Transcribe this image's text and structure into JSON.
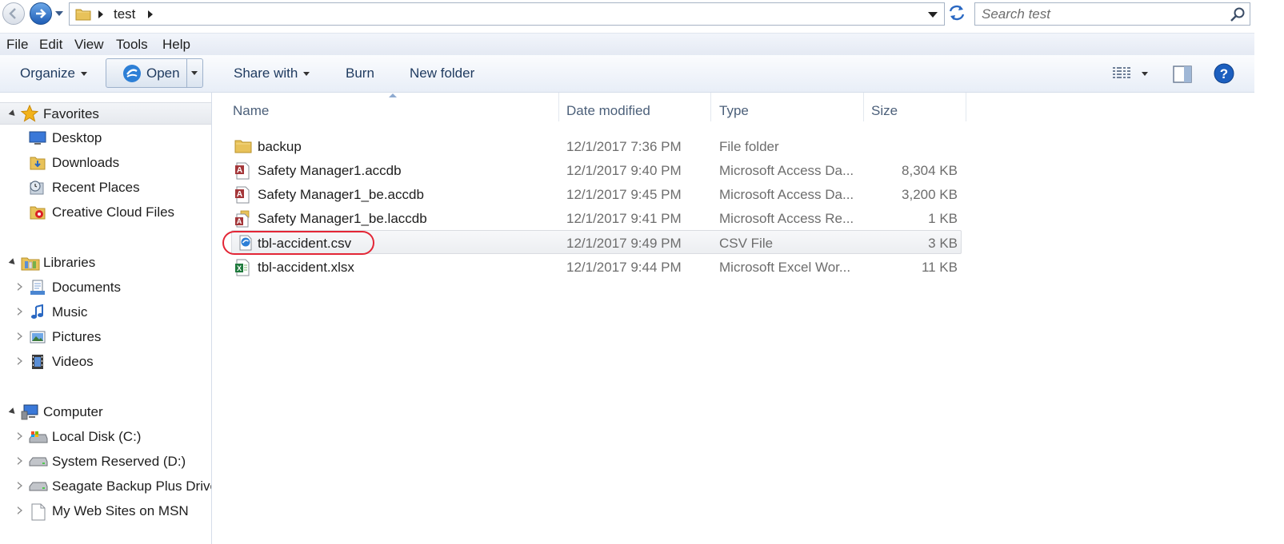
{
  "address": {
    "path": "test",
    "search_placeholder": "Search test"
  },
  "menu": [
    "File",
    "Edit",
    "View",
    "Tools",
    "Help"
  ],
  "toolbar": {
    "organize": "Organize",
    "open": "Open",
    "share_with": "Share with",
    "burn": "Burn",
    "new_folder": "New folder"
  },
  "nav": {
    "favorites": "Favorites",
    "favorites_items": [
      "Desktop",
      "Downloads",
      "Recent Places",
      "Creative Cloud Files"
    ],
    "libraries": "Libraries",
    "libraries_items": [
      "Documents",
      "Music",
      "Pictures",
      "Videos"
    ],
    "computer": "Computer",
    "computer_items": [
      "Local Disk (C:)",
      "System Reserved (D:)",
      "Seagate Backup Plus Drive",
      "My Web Sites on MSN"
    ]
  },
  "columns": {
    "name": "Name",
    "date": "Date modified",
    "type": "Type",
    "size": "Size"
  },
  "files": [
    {
      "name": "backup",
      "date": "12/1/2017 7:36 PM",
      "type": "File folder",
      "size": "",
      "icon": "folder-icon"
    },
    {
      "name": "Safety Manager1.accdb",
      "date": "12/1/2017 9:40 PM",
      "type": "Microsoft Access Da...",
      "size": "8,304 KB",
      "icon": "access-file-icon"
    },
    {
      "name": "Safety Manager1_be.accdb",
      "date": "12/1/2017 9:45 PM",
      "type": "Microsoft Access Da...",
      "size": "3,200 KB",
      "icon": "access-file-icon"
    },
    {
      "name": "Safety Manager1_be.laccdb",
      "date": "12/1/2017 9:41 PM",
      "type": "Microsoft Access Re...",
      "size": "1 KB",
      "icon": "access-lock-file-icon"
    },
    {
      "name": "tbl-accident.csv",
      "date": "12/1/2017 9:49 PM",
      "type": "CSV File",
      "size": "3 KB",
      "icon": "csv-file-icon"
    },
    {
      "name": "tbl-accident.xlsx",
      "date": "12/1/2017 9:44 PM",
      "type": "Microsoft Excel Wor...",
      "size": "11 KB",
      "icon": "excel-file-icon"
    }
  ],
  "selected_file": "tbl-accident.csv",
  "colors": {
    "accent": "#1f5db5",
    "highlight_ring": "#e32636",
    "header_text": "#4c607a"
  }
}
